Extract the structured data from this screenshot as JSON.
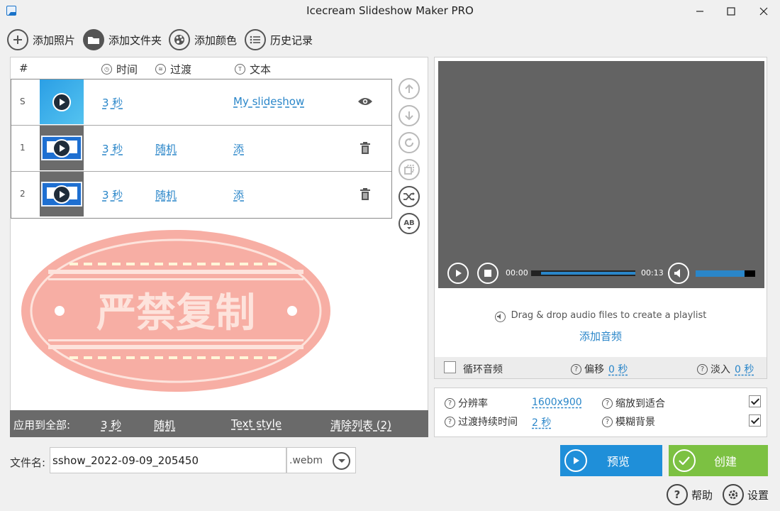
{
  "window": {
    "title": "Icecream Slideshow Maker PRO"
  },
  "toolbar": {
    "add_photos": "添加照片",
    "add_folder": "添加文件夹",
    "add_color": "添加颜色",
    "history": "历史记录"
  },
  "table": {
    "headers": {
      "num": "#",
      "time": "时间",
      "transition": "过渡",
      "text": "文本"
    },
    "rows": [
      {
        "num": "S",
        "time": "3 秒",
        "transition": "",
        "text": "My slideshow",
        "action_icon": "eye-icon"
      },
      {
        "num": "1",
        "time": "3 秒",
        "transition": "随机",
        "text": "添",
        "action_icon": "trash-icon"
      },
      {
        "num": "2",
        "time": "3 秒",
        "transition": "随机",
        "text": "添",
        "action_icon": "trash-icon"
      }
    ]
  },
  "watermark": {
    "text": "严禁复制"
  },
  "apply_bar": {
    "label": "应用到全部:",
    "time": "3 秒",
    "transition": "随机",
    "text_style": "Text style",
    "clear_list": "清除列表 (2)"
  },
  "player": {
    "current_time": "00:00",
    "total_time": "00:13",
    "progress": 1.0,
    "volume": 0.82
  },
  "audio": {
    "drop_hint": "Drag & drop audio files to create a playlist",
    "add_audio": "添加音频",
    "loop_label": "循环音频",
    "loop_checked": false,
    "offset_label": "偏移",
    "offset_value": "0 秒",
    "fadein_label": "淡入",
    "fadein_value": "0 秒"
  },
  "settings": {
    "resolution_label": "分辨率",
    "resolution_value": "1600x900",
    "transition_duration_label": "过渡持续时间",
    "transition_duration_value": "2 秒",
    "zoom_fit_label": "缩放到适合",
    "zoom_fit_checked": true,
    "blur_bg_label": "模糊背景",
    "blur_bg_checked": true
  },
  "file": {
    "label": "文件名:",
    "name": "sshow_2022-09-09_205450",
    "extension": ".webm"
  },
  "actions": {
    "preview": "预览",
    "create": "创建",
    "help": "帮助",
    "settings": "设置"
  },
  "colors": {
    "accent": "#2a86c9",
    "preview_button": "#1f8fd9",
    "create_button": "#7cc142",
    "watermark": "#f2877c"
  }
}
